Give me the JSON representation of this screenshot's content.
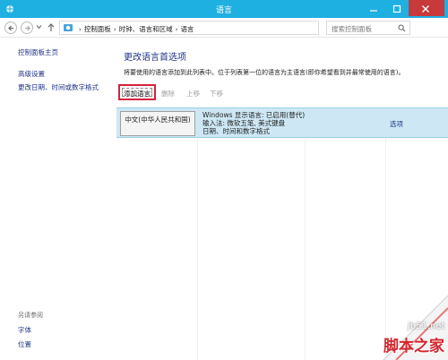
{
  "window": {
    "title": "语言"
  },
  "address_bar": {
    "breadcrumbs": [
      "控制面板",
      "时钟、语言和区域",
      "语言"
    ],
    "search_placeholder": "搜索控制面板"
  },
  "left_nav": {
    "home": "控制面板主页",
    "advanced": "高级设置",
    "date_time": "更改日期、时间或数字格式",
    "see_also": "另请参阅",
    "fonts": "字体",
    "location": "位置"
  },
  "main": {
    "heading": "更改语言首选项",
    "description": "将要使用的语言添加到此列表中。位于列表第一位的语言为主语言(即你希望看到并最常使用的语言)。",
    "toolbar": {
      "add": "添加语言",
      "remove": "删除",
      "move_up": "上移",
      "move_down": "下移"
    },
    "languages": [
      {
        "name": "中文(中华人民共和国)",
        "display_language": "Windows 显示语言: 已启用(替代)",
        "input_method": "输入法: 微软五笔, 美式键盘",
        "date_format": "日期、时间和数字格式",
        "options": "选项"
      }
    ]
  },
  "watermark": {
    "url": "jb51.net",
    "brand": "脚本之家"
  },
  "colors": {
    "titlebar": "#1fb0e2",
    "close": "#c7393a",
    "link": "#1e3287",
    "selected_row": "#cde8f4",
    "highlight_box": "#d4223c"
  }
}
